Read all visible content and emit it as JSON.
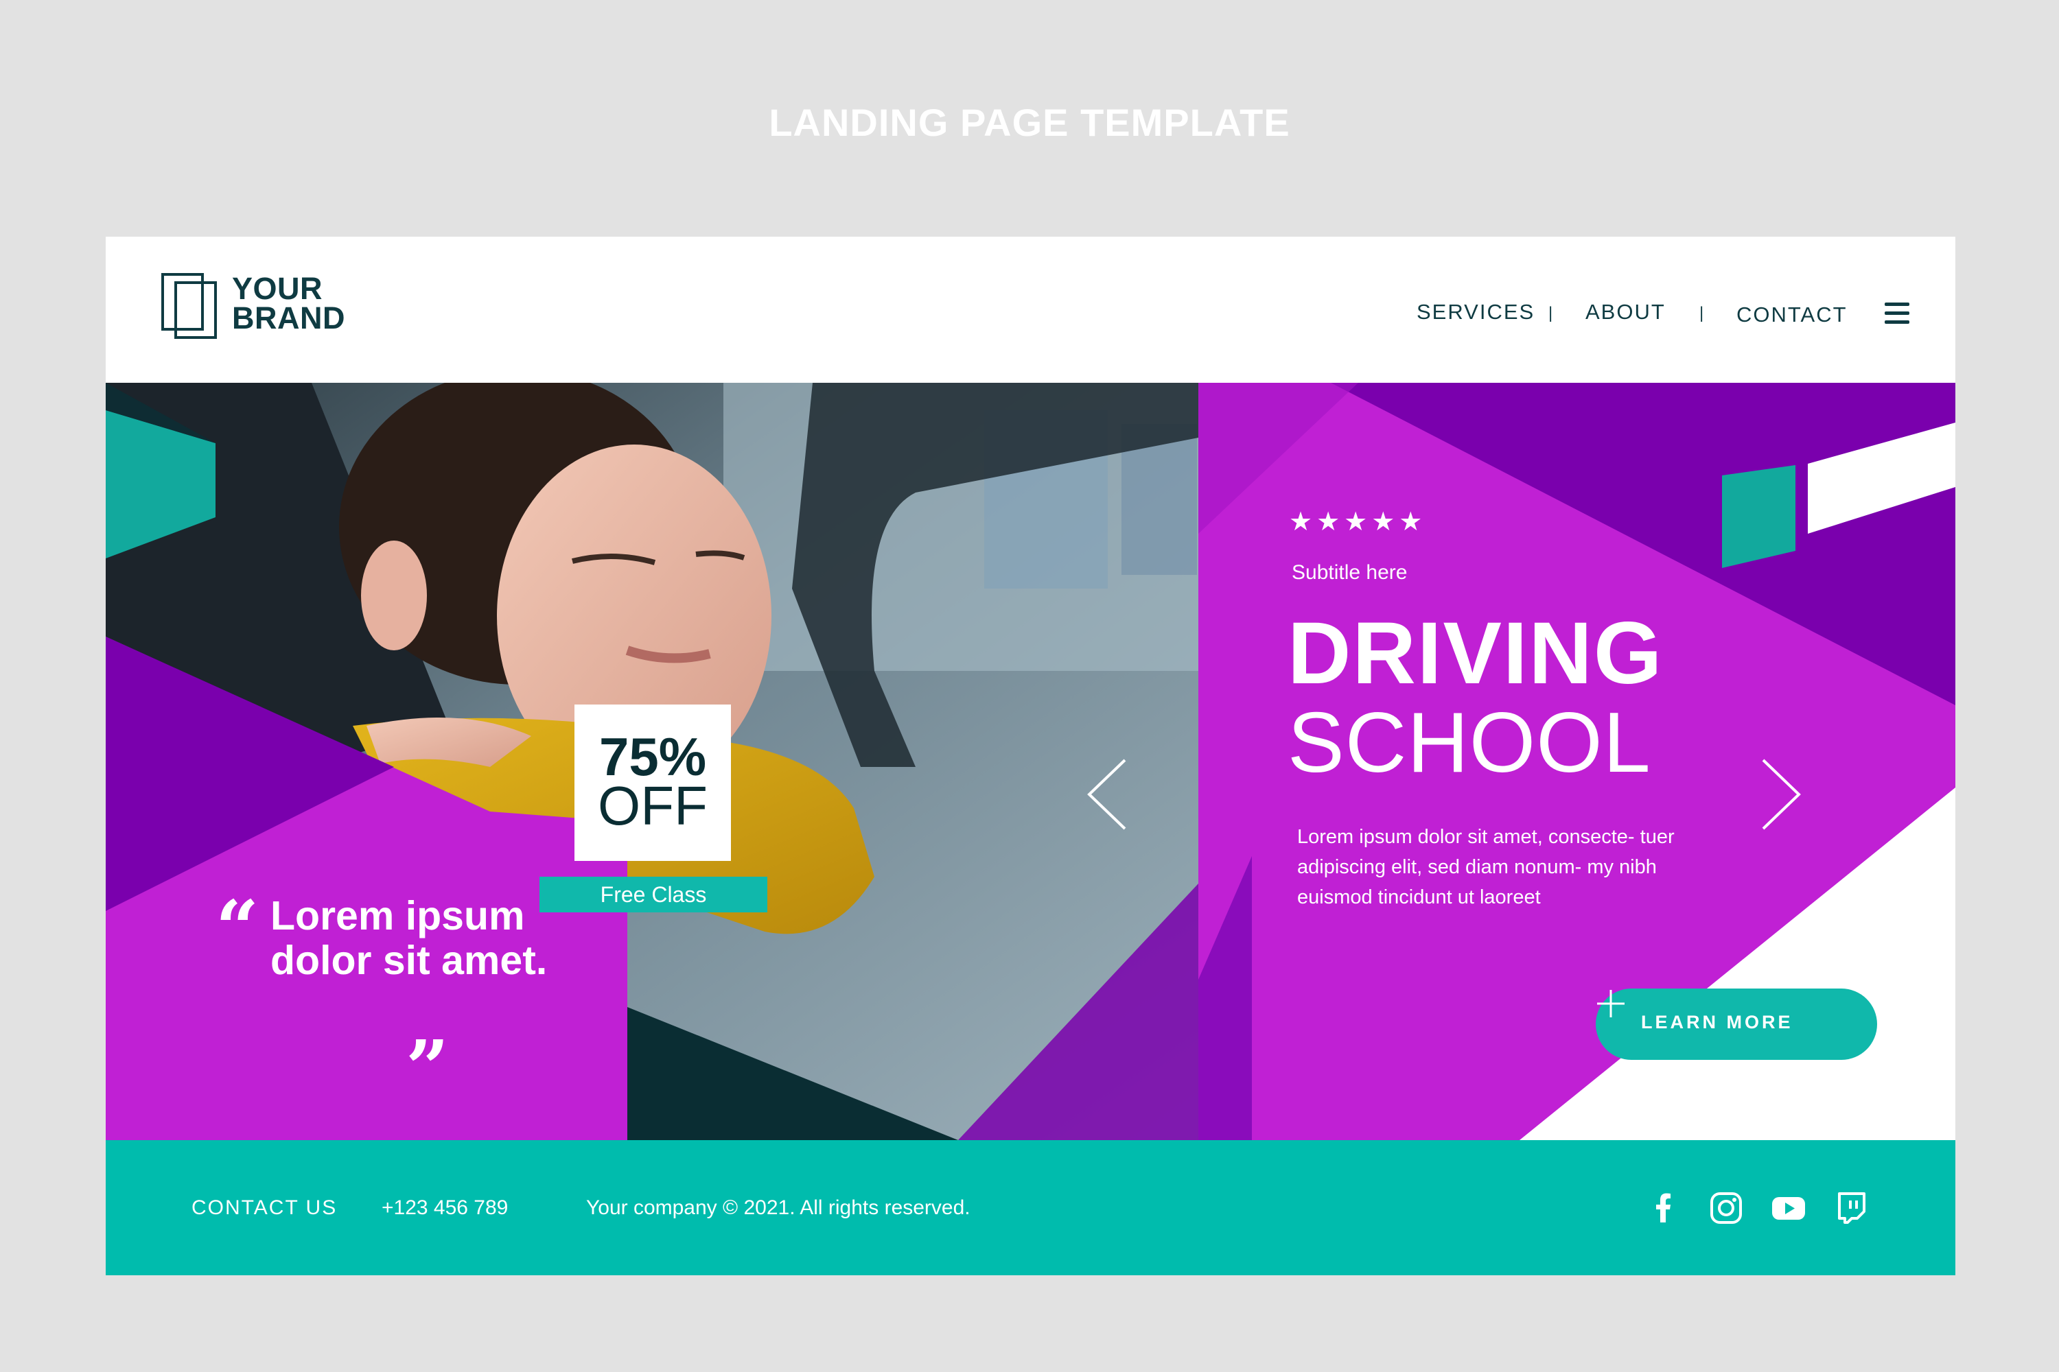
{
  "page": {
    "heading": "LANDING PAGE TEMPLATE"
  },
  "header": {
    "logo": {
      "line1": "YOUR",
      "line2": "BRAND"
    },
    "nav": [
      {
        "label": "SERVICES"
      },
      {
        "label": "ABOUT"
      },
      {
        "label": "CONTACT"
      }
    ],
    "separator": "|",
    "menu_icon": "hamburger-icon"
  },
  "hero": {
    "rating_stars": "★★★★★",
    "subtitle": "Subtitle here",
    "title_bold": "DRIVING",
    "title_light": "SCHOOL",
    "description": "Lorem ipsum dolor sit amet, consecte- tuer adipiscing elit, sed diam nonum- my nibh euismod tincidunt ut laoreet",
    "quote": "Lorem ipsum dolor sit amet.",
    "quote_open": "“",
    "quote_close": "”",
    "discount": {
      "percent": "75%",
      "off": "OFF"
    },
    "badge": "Free Class",
    "cta_label": "LEARN MORE",
    "arrows": [
      "chevron-left-icon",
      "chevron-right-icon"
    ]
  },
  "footer": {
    "contact_label": "CONTACT US",
    "phone": "+123 456 789",
    "copyright": "Your company © 2021. All rights reserved.",
    "social_icons": [
      "facebook-icon",
      "instagram-icon",
      "youtube-icon",
      "twitch-icon"
    ]
  },
  "colors": {
    "purple": "#c020d4",
    "dark_purple": "#7a00ad",
    "teal": "#10b8ab",
    "navy": "#0f3b42",
    "background": "#e2e2e2"
  }
}
